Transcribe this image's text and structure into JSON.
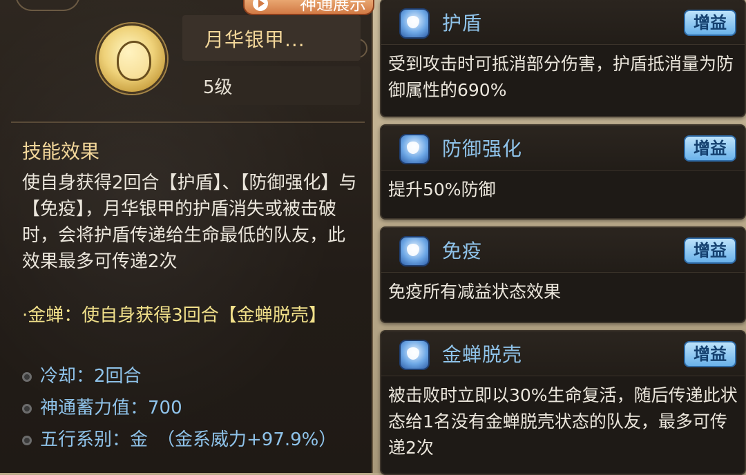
{
  "skill": {
    "demo_button": "神通展示",
    "name": "月华银甲...",
    "level": "5级",
    "section_title": "技能效果",
    "description": "使自身获得2回合【护盾】、【防御强化】与【免疫】，月华银甲的护盾消失或被击破时，会将护盾传递给生命最低的队友，此效果最多可传递2次",
    "extra_effect": "·金蝉：使自身获得3回合【金蝉脱壳】",
    "cooldown": "冷却：2回合",
    "charge": "神通蓄力值：700",
    "element": "五行系别：金　（金系威力+97.9%）"
  },
  "buffs": [
    {
      "name": "护盾",
      "tag": "增益",
      "icon": "shield-dome-icon",
      "description": "受到攻击时可抵消部分伤害，护盾抵消量为防御属性的690%"
    },
    {
      "name": "防御强化",
      "tag": "增益",
      "icon": "shield-icon",
      "description": "提升50%防御"
    },
    {
      "name": "免疫",
      "tag": "增益",
      "icon": "wings-icon",
      "description": "免疫所有减益状态效果"
    },
    {
      "name": "金蝉脱壳",
      "tag": "增益",
      "icon": "cicada-shell-icon",
      "description": "被击败时立即以30%生命复活，随后传递此状态给1名没有金蝉脱壳状态的队友，最多可传递2次"
    }
  ],
  "colors": {
    "panel_bg": "#221c17",
    "title_gold": "#f3d79a",
    "stat_blue": "#8fc3ea",
    "extra_yellow": "#f1e08a",
    "tag_blue": "#6ab2ea"
  }
}
